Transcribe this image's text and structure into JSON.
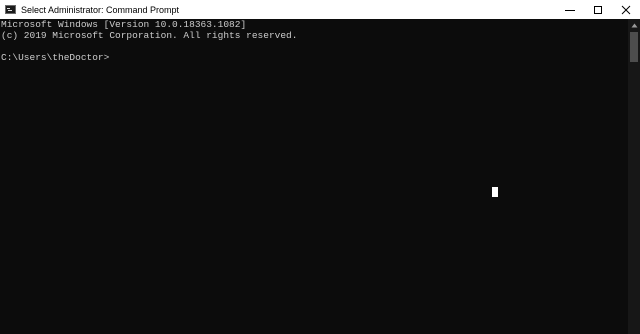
{
  "window": {
    "title": "Select Administrator: Command Prompt",
    "icon": "cmd-icon",
    "controls": {
      "minimize": "minimize-icon",
      "maximize": "maximize-icon",
      "close": "close-icon"
    }
  },
  "console": {
    "lines": [
      "Microsoft Windows [Version 10.0.18363.1082]",
      "(c) 2019 Microsoft Corporation. All rights reserved.",
      ""
    ],
    "prompt": "C:\\Users\\theDoctor>",
    "input_value": ""
  },
  "colors": {
    "background": "#0c0c0c",
    "text": "#cccccc",
    "titlebar": "#ffffff"
  }
}
